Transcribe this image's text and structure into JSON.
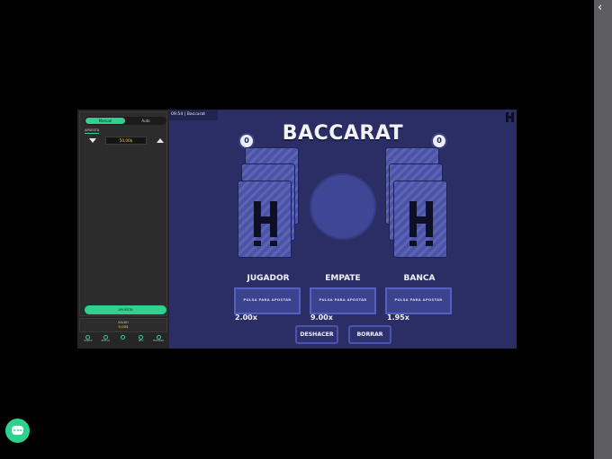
{
  "sidebar": {
    "mode_manual": "Manual",
    "mode_auto": "Auto",
    "bet_label": "APUESTA",
    "bet_value": "50,00$",
    "bet_button": "APUESTA",
    "saldo_label": "SALDO",
    "saldo_value": "0,00$",
    "nav": [
      {
        "label": "SONIDO",
        "icon": "speaker-icon"
      },
      {
        "label": "REGLAS",
        "icon": "rules-icon"
      },
      {
        "label": "·",
        "icon": "menu-icon"
      },
      {
        "label": "INFO",
        "icon": "info-icon"
      },
      {
        "label": "HISTORIAL",
        "icon": "history-icon"
      }
    ]
  },
  "game": {
    "time": "09:54",
    "separator": "|",
    "game_name": "Baccarat",
    "title": "BACCARAT",
    "player_score": "0",
    "banker_score": "0",
    "areas": [
      {
        "label": "JUGADOR",
        "bet_prompt": "PULSA PARA APOSTAR",
        "multiplier": "2.00x"
      },
      {
        "label": "EMPATE",
        "bet_prompt": "PULSA PARA APOSTAR",
        "multiplier": "9.00x"
      },
      {
        "label": "BANCA",
        "bet_prompt": "PULSA PARA APOSTAR",
        "multiplier": "1.95x"
      }
    ],
    "undo_button": "DESHACER",
    "clear_button": "BORRAR"
  },
  "colors": {
    "accent_green": "#2ed18e",
    "table_blue": "#2a2e64",
    "card_blue": "#4a53a8",
    "bet_yellow": "#ffcf3a"
  }
}
